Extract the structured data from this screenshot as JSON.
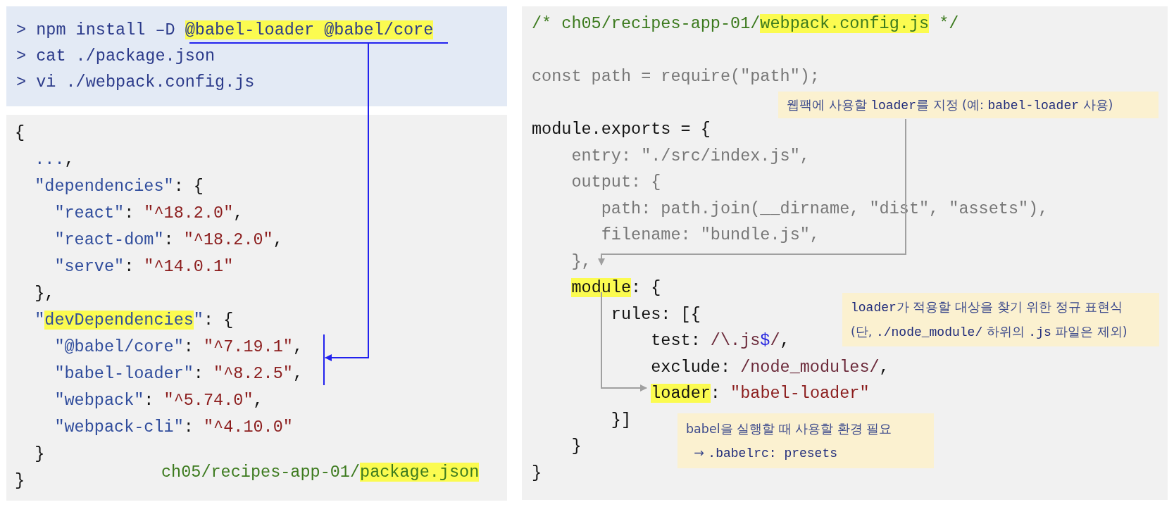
{
  "command_panel": {
    "lines": [
      {
        "segments": [
          {
            "text": "> npm install –D ",
            "kind": "cmd"
          },
          {
            "text": "@babel-loader @babel/core",
            "kind": "cmd_hl"
          }
        ]
      },
      {
        "segments": [
          {
            "text": "> cat ./package.json",
            "kind": "cmd"
          }
        ]
      },
      {
        "segments": [
          {
            "text": "> vi ./webpack.config.js",
            "kind": "cmd"
          }
        ]
      }
    ]
  },
  "package_json": {
    "lines": [
      {
        "segments": [
          {
            "text": "{",
            "kind": "plain"
          }
        ]
      },
      {
        "segments": [
          {
            "text": "  ...",
            "kind": "key"
          },
          {
            "text": ",",
            "kind": "plain"
          }
        ]
      },
      {
        "segments": [
          {
            "text": "  \"dependencies\"",
            "kind": "key"
          },
          {
            "text": ": {",
            "kind": "plain"
          }
        ]
      },
      {
        "segments": [
          {
            "text": "    \"react\"",
            "kind": "key"
          },
          {
            "text": ": ",
            "kind": "plain"
          },
          {
            "text": "\"^18.2.0\"",
            "kind": "str"
          },
          {
            "text": ",",
            "kind": "plain"
          }
        ]
      },
      {
        "segments": [
          {
            "text": "    \"react-dom\"",
            "kind": "key"
          },
          {
            "text": ": ",
            "kind": "plain"
          },
          {
            "text": "\"^18.2.0\"",
            "kind": "str"
          },
          {
            "text": ",",
            "kind": "plain"
          }
        ]
      },
      {
        "segments": [
          {
            "text": "    \"serve\"",
            "kind": "key"
          },
          {
            "text": ": ",
            "kind": "plain"
          },
          {
            "text": "\"^14.0.1\"",
            "kind": "str"
          }
        ]
      },
      {
        "segments": [
          {
            "text": "  },",
            "kind": "plain"
          }
        ]
      },
      {
        "segments": [
          {
            "text": "  \"",
            "kind": "key"
          },
          {
            "text": "devDependencies",
            "kind": "key_hl"
          },
          {
            "text": "\"",
            "kind": "key"
          },
          {
            "text": ": {",
            "kind": "plain"
          }
        ]
      },
      {
        "segments": [
          {
            "text": "    \"@babel/core\"",
            "kind": "key"
          },
          {
            "text": ": ",
            "kind": "plain"
          },
          {
            "text": "\"^7.19.1\"",
            "kind": "str"
          },
          {
            "text": ",",
            "kind": "plain"
          }
        ]
      },
      {
        "segments": [
          {
            "text": "    \"babel-loader\"",
            "kind": "key"
          },
          {
            "text": ": ",
            "kind": "plain"
          },
          {
            "text": "\"^8.2.5\"",
            "kind": "str"
          },
          {
            "text": ",",
            "kind": "plain"
          }
        ]
      },
      {
        "segments": [
          {
            "text": "    \"webpack\"",
            "kind": "key"
          },
          {
            "text": ": ",
            "kind": "plain"
          },
          {
            "text": "\"^5.74.0\"",
            "kind": "str"
          },
          {
            "text": ",",
            "kind": "plain"
          }
        ]
      },
      {
        "segments": [
          {
            "text": "    \"webpack-cli\"",
            "kind": "key"
          },
          {
            "text": ": ",
            "kind": "plain"
          },
          {
            "text": "\"^4.10.0\"",
            "kind": "str"
          }
        ]
      },
      {
        "segments": [
          {
            "text": "  }",
            "kind": "plain"
          }
        ]
      },
      {
        "segments": [
          {
            "text": "}",
            "kind": "plain"
          }
        ]
      }
    ],
    "caption": {
      "segments": [
        {
          "text": "ch05/recipes-app-01/",
          "kind": "comment"
        },
        {
          "text": "package.json",
          "kind": "comment_hl"
        }
      ]
    }
  },
  "webpack_config": {
    "lines": [
      {
        "kind": "code",
        "segments": [
          {
            "text": "/* ch05/recipes-app-01/",
            "kind": "comment"
          },
          {
            "text": "webpack.config.js",
            "kind": "comment_hl"
          },
          {
            "text": " */",
            "kind": "comment"
          }
        ]
      },
      {
        "kind": "blank"
      },
      {
        "kind": "code",
        "segments": [
          {
            "text": "const path = require(\"path\");",
            "kind": "dim"
          }
        ]
      },
      {
        "kind": "blank"
      },
      {
        "kind": "code",
        "segments": [
          {
            "text": "module.exports = {",
            "kind": "plain"
          }
        ]
      },
      {
        "kind": "code",
        "segments": [
          {
            "text": "    entry: \"./src/index.js\",",
            "kind": "dim"
          }
        ]
      },
      {
        "kind": "code",
        "segments": [
          {
            "text": "    output: {",
            "kind": "dim"
          }
        ]
      },
      {
        "kind": "code",
        "segments": [
          {
            "text": "       path: path.join(__dirname, \"dist\", \"assets\"),",
            "kind": "dim"
          }
        ]
      },
      {
        "kind": "code",
        "segments": [
          {
            "text": "       filename: \"bundle.js\",",
            "kind": "dim"
          }
        ]
      },
      {
        "kind": "code",
        "segments": [
          {
            "text": "    },",
            "kind": "dim"
          }
        ]
      },
      {
        "kind": "code",
        "segments": [
          {
            "text": "    module",
            "kind": "plain_hl"
          },
          {
            "text": ": {",
            "kind": "plain"
          }
        ]
      },
      {
        "kind": "code",
        "segments": [
          {
            "text": "        rules: [{",
            "kind": "plain"
          }
        ]
      },
      {
        "kind": "code",
        "segments": [
          {
            "text": "            test: ",
            "kind": "plain"
          },
          {
            "text": "/\\.js",
            "kind": "regex"
          },
          {
            "text": "$",
            "kind": "dollar"
          },
          {
            "text": "/",
            "kind": "regex"
          },
          {
            "text": ",",
            "kind": "plain"
          }
        ]
      },
      {
        "kind": "code",
        "segments": [
          {
            "text": "            exclude: ",
            "kind": "plain"
          },
          {
            "text": "/node_modules/",
            "kind": "regex"
          },
          {
            "text": ",",
            "kind": "plain"
          }
        ]
      },
      {
        "kind": "code",
        "segments": [
          {
            "text": "            loader",
            "kind": "plain_hl"
          },
          {
            "text": ": ",
            "kind": "plain"
          },
          {
            "text": "\"babel-loader\"",
            "kind": "str"
          }
        ]
      },
      {
        "kind": "code",
        "segments": [
          {
            "text": "        }]",
            "kind": "plain"
          }
        ]
      },
      {
        "kind": "code",
        "segments": [
          {
            "text": "    }",
            "kind": "plain"
          }
        ]
      },
      {
        "kind": "code",
        "segments": [
          {
            "text": "}",
            "kind": "plain"
          }
        ]
      }
    ]
  },
  "notes": [
    {
      "lines": [
        {
          "segments": [
            {
              "text": "웹팩에 사용할 ",
              "kind": "text"
            },
            {
              "text": "loader",
              "kind": "code"
            },
            {
              "text": "를 지정 (예: ",
              "kind": "text"
            },
            {
              "text": "babel-loader",
              "kind": "code"
            },
            {
              "text": " 사용)",
              "kind": "text"
            }
          ]
        }
      ]
    },
    {
      "lines": [
        {
          "segments": [
            {
              "text": "loader",
              "kind": "code"
            },
            {
              "text": "가 적용할 대상을 찾기 위한 정규 표현식",
              "kind": "text"
            }
          ]
        },
        {
          "segments": [
            {
              "text": "(단, ",
              "kind": "text"
            },
            {
              "text": "./node_module/",
              "kind": "code"
            },
            {
              "text": " 하위의 ",
              "kind": "text"
            },
            {
              "text": ".js",
              "kind": "code"
            },
            {
              "text": " 파일은 제외)",
              "kind": "text"
            }
          ]
        }
      ]
    },
    {
      "lines": [
        {
          "segments": [
            {
              "text": "babel을 실행할 때 사용할 환경 필요",
              "kind": "text"
            }
          ]
        },
        {
          "segments": [
            {
              "text": "  → ",
              "kind": "text"
            },
            {
              "text": ".babelrc: presets",
              "kind": "code"
            }
          ]
        }
      ]
    }
  ]
}
